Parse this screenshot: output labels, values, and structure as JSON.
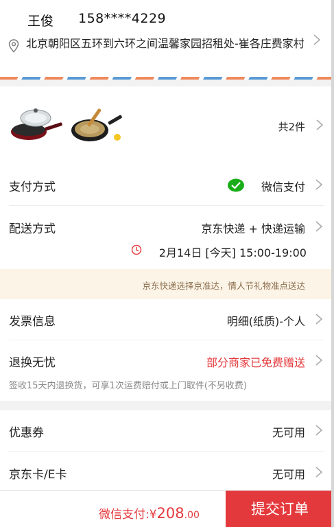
{
  "address": {
    "name": "王俊",
    "phone": "158****4229",
    "detail": "北京朝阳区五环到六环之间温馨家园招租处-崔各庄费家村"
  },
  "products": {
    "count_label": "共2件",
    "items": [
      {
        "icon": "red-frying-pan-image"
      },
      {
        "icon": "black-frying-pan-image"
      }
    ]
  },
  "payment": {
    "label": "支付方式",
    "value": "微信支付",
    "icon": "wechat-pay-icon",
    "icon_color": "#1aad19"
  },
  "delivery": {
    "label": "配送方式",
    "value": "京东快递 + 快递运输",
    "time": "2月14日 [今天] 15:00-19:00",
    "notice": "京东快递选择京准达，情人节礼物准点送达"
  },
  "invoice": {
    "label": "发票信息",
    "value": "明细(纸质)-个人"
  },
  "returns": {
    "label": "退换无忧",
    "value": "部分商家已免费赠送",
    "note": "签收15天内退换货，可享1次运费赔付或上门取件(不另收费)"
  },
  "coupon": {
    "label": "优惠券",
    "value": "无可用"
  },
  "jdcard": {
    "label": "京东卡/E卡",
    "value": "无可用"
  },
  "footer": {
    "total_prefix": "微信支付:¥",
    "total_int": "208",
    "total_dec": ".00",
    "submit_label": "提交订单"
  },
  "colors": {
    "accent": "#e4393c",
    "notice_bg": "#fcf4e6"
  }
}
